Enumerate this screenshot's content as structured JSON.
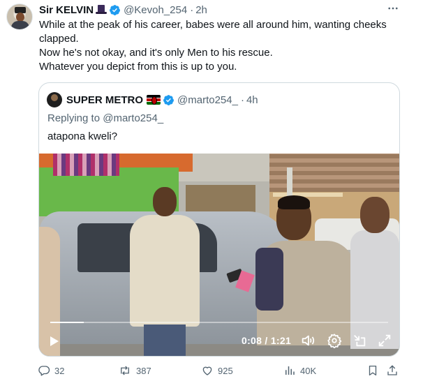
{
  "tweet": {
    "author_name": "Sir KELVIN",
    "author_emoji": "top-hat",
    "verified": true,
    "handle": "@Kevoh_254",
    "separator": "·",
    "time": "2h",
    "more_icon": "more-dots-icon",
    "text_lines": [
      "While at the peak of his career, babes were all around him, wanting cheeks clapped.",
      "Now he's not okay, and it's only Men to his rescue.",
      "Whatever you depict from this is up to you."
    ]
  },
  "quote": {
    "author_name": "SUPER METRO",
    "author_emoji": "kenya-flag",
    "verified": true,
    "handle": "@marto254_",
    "separator": "·",
    "time": "4h",
    "replying_prefix": "Replying to",
    "replying_to": "@marto254_",
    "text": "atapona kweli?",
    "video": {
      "current_time": "0:08",
      "duration": "1:21",
      "time_separator": " / ",
      "progress_fraction": 0.099,
      "controls": [
        "play-icon",
        "volume-icon",
        "settings-icon",
        "collapse-icon",
        "fullscreen-icon"
      ]
    }
  },
  "actions": {
    "replies": "32",
    "retweets": "387",
    "likes": "925",
    "views": "40K"
  },
  "colors": {
    "text": "#0f1419",
    "muted": "#536471",
    "verified": "#1d9bf0",
    "border": "#cfd9de"
  }
}
